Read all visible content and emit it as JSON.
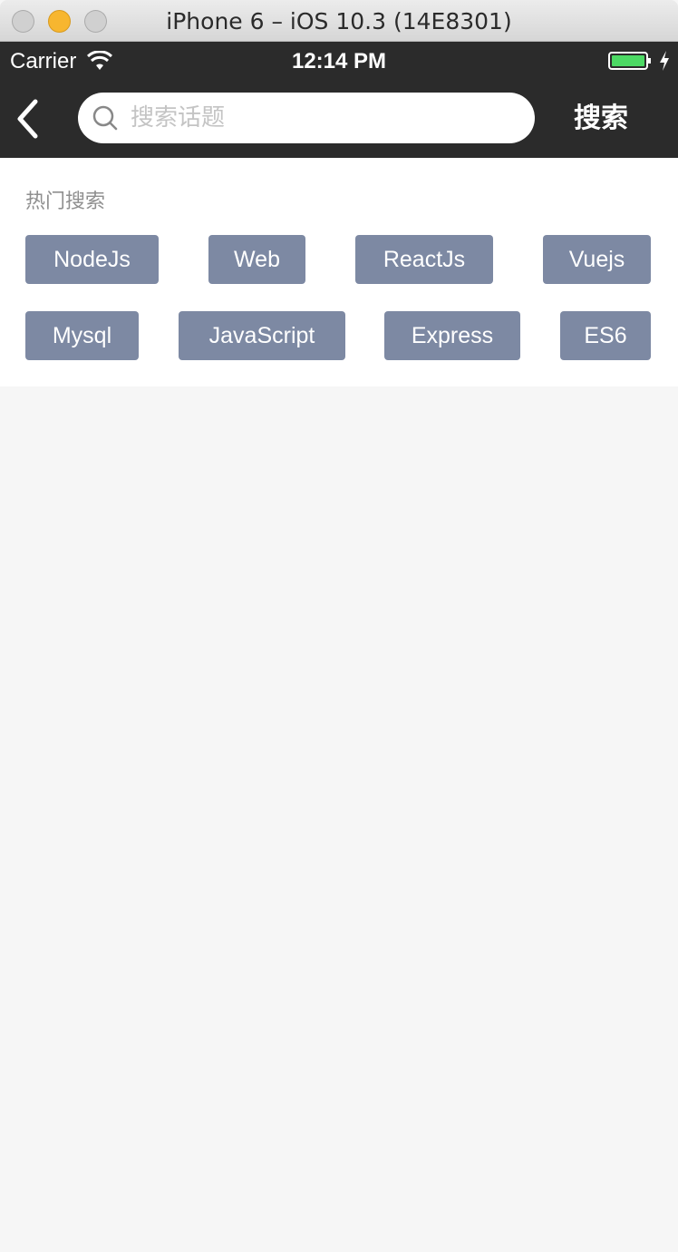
{
  "window": {
    "title": "iPhone 6 – iOS 10.3 (14E8301)"
  },
  "status_bar": {
    "carrier": "Carrier",
    "time": "12:14 PM",
    "wifi_icon": "wifi-icon",
    "battery_icon": "battery-icon",
    "charging_icon": "charging-bolt-icon"
  },
  "header": {
    "back_icon": "chevron-left-icon",
    "search_placeholder": "搜索话题",
    "search_value": "",
    "search_button": "搜索"
  },
  "hot_search": {
    "title": "热门搜索",
    "tags": [
      "NodeJs",
      "Web",
      "ReactJs",
      "Vuejs",
      "Mysql",
      "JavaScript",
      "Express",
      "ES6"
    ]
  },
  "colors": {
    "nav_background": "#2b2b2b",
    "tag_background": "#7d89a3",
    "page_background": "#f6f6f6",
    "panel_background": "#ffffff",
    "battery_fill": "#4cd964"
  }
}
